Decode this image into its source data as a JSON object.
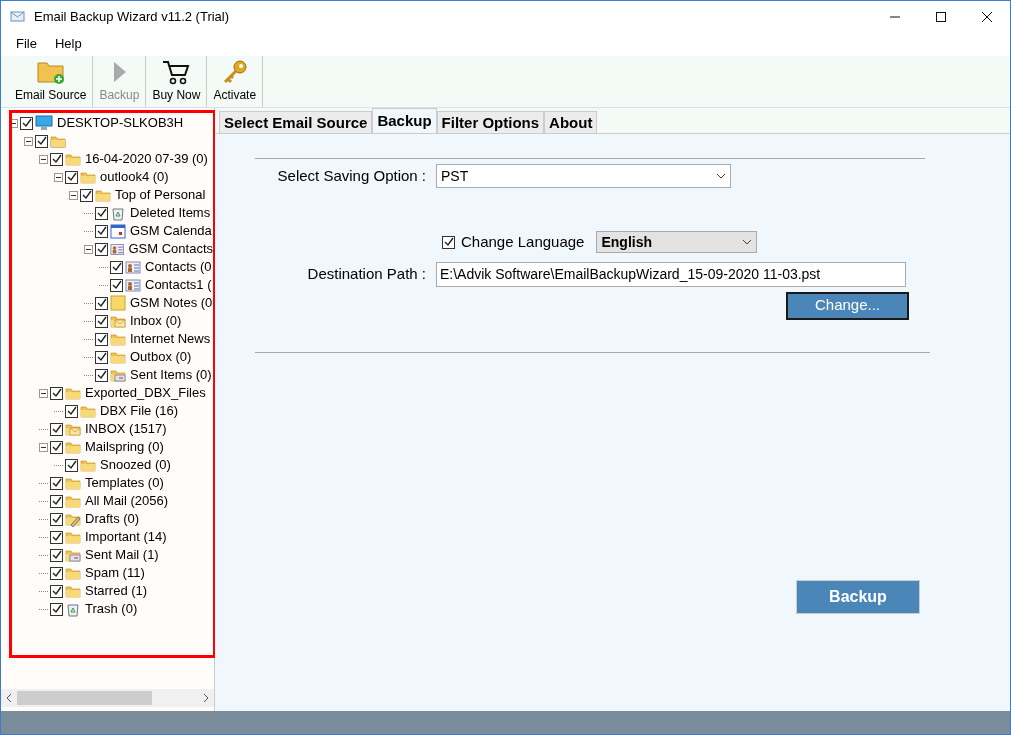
{
  "window": {
    "title": "Email Backup Wizard v11.2 (Trial)"
  },
  "menu": [
    "File",
    "Help"
  ],
  "toolbar": [
    {
      "label": "Email Source",
      "kind": "source",
      "disabled": false
    },
    {
      "label": "Backup",
      "kind": "backup",
      "disabled": true
    },
    {
      "label": "Buy Now",
      "kind": "cart",
      "disabled": false
    },
    {
      "label": "Activate",
      "kind": "key",
      "disabled": false
    }
  ],
  "tree": [
    {
      "label": "DESKTOP-SLKOB3H",
      "kind": "computer",
      "checked": true,
      "expanded": true,
      "children": [
        {
          "kind": "stack",
          "checked": true,
          "expanded": true,
          "children": [
            {
              "label": "16-04-2020 07-39 (0)",
              "kind": "folder",
              "checked": true,
              "expanded": true,
              "children": [
                {
                  "label": "outlook4 (0)",
                  "kind": "folder",
                  "checked": true,
                  "expanded": true,
                  "children": [
                    {
                      "label": "Top of Personal",
                      "kind": "folder",
                      "checked": true,
                      "expanded": true,
                      "children": [
                        {
                          "label": "Deleted Items",
                          "kind": "trash",
                          "checked": true
                        },
                        {
                          "label": "GSM Calenda",
                          "kind": "calendar",
                          "checked": true
                        },
                        {
                          "label": "GSM Contacts",
                          "kind": "contacts",
                          "checked": true,
                          "expanded": true,
                          "children": [
                            {
                              "label": "Contacts (0",
                              "kind": "contacts",
                              "checked": true
                            },
                            {
                              "label": "Contacts1 (",
                              "kind": "contacts",
                              "checked": true
                            }
                          ]
                        },
                        {
                          "label": "GSM Notes (0",
                          "kind": "notes",
                          "checked": true
                        },
                        {
                          "label": "Inbox (0)",
                          "kind": "mail",
                          "checked": true
                        },
                        {
                          "label": "Internet News",
                          "kind": "folder",
                          "checked": true
                        },
                        {
                          "label": "Outbox (0)",
                          "kind": "folder",
                          "checked": true
                        },
                        {
                          "label": "Sent Items (0)",
                          "kind": "sent",
                          "checked": true
                        }
                      ]
                    }
                  ]
                }
              ]
            },
            {
              "label": "Exported_DBX_Files",
              "kind": "folder",
              "checked": true,
              "expanded": true,
              "children": [
                {
                  "label": "DBX File (16)",
                  "kind": "folder",
                  "checked": true
                }
              ]
            },
            {
              "label": "INBOX (1517)",
              "kind": "mail",
              "checked": true
            },
            {
              "label": "Mailspring (0)",
              "kind": "folder",
              "checked": true,
              "expanded": true,
              "children": [
                {
                  "label": "Snoozed (0)",
                  "kind": "folder",
                  "checked": true
                }
              ]
            },
            {
              "label": "Templates (0)",
              "kind": "folder",
              "checked": true
            },
            {
              "label": "All Mail (2056)",
              "kind": "folder",
              "checked": true
            },
            {
              "label": "Drafts (0)",
              "kind": "drafts",
              "checked": true
            },
            {
              "label": "Important (14)",
              "kind": "folder",
              "checked": true
            },
            {
              "label": "Sent Mail (1)",
              "kind": "sent",
              "checked": true
            },
            {
              "label": "Spam (11)",
              "kind": "folder",
              "checked": true
            },
            {
              "label": "Starred (1)",
              "kind": "folder",
              "checked": true
            },
            {
              "label": "Trash (0)",
              "kind": "trash",
              "checked": true
            }
          ]
        }
      ]
    }
  ],
  "tabs": [
    {
      "label": "Select Email Source",
      "selected": false
    },
    {
      "label": "Backup",
      "selected": true
    },
    {
      "label": "Filter Options",
      "selected": false
    },
    {
      "label": "About",
      "selected": false
    }
  ],
  "saving_option": {
    "label": "Select Saving Option :",
    "value": "PST"
  },
  "change_language": {
    "label": "Change Language",
    "checked": true,
    "value": "English"
  },
  "destination": {
    "label": "Destination Path :",
    "value": "E:\\Advik Software\\EmailBackupWizard_15-09-2020 11-03.pst",
    "button": "Change..."
  },
  "backup_button": "Backup"
}
